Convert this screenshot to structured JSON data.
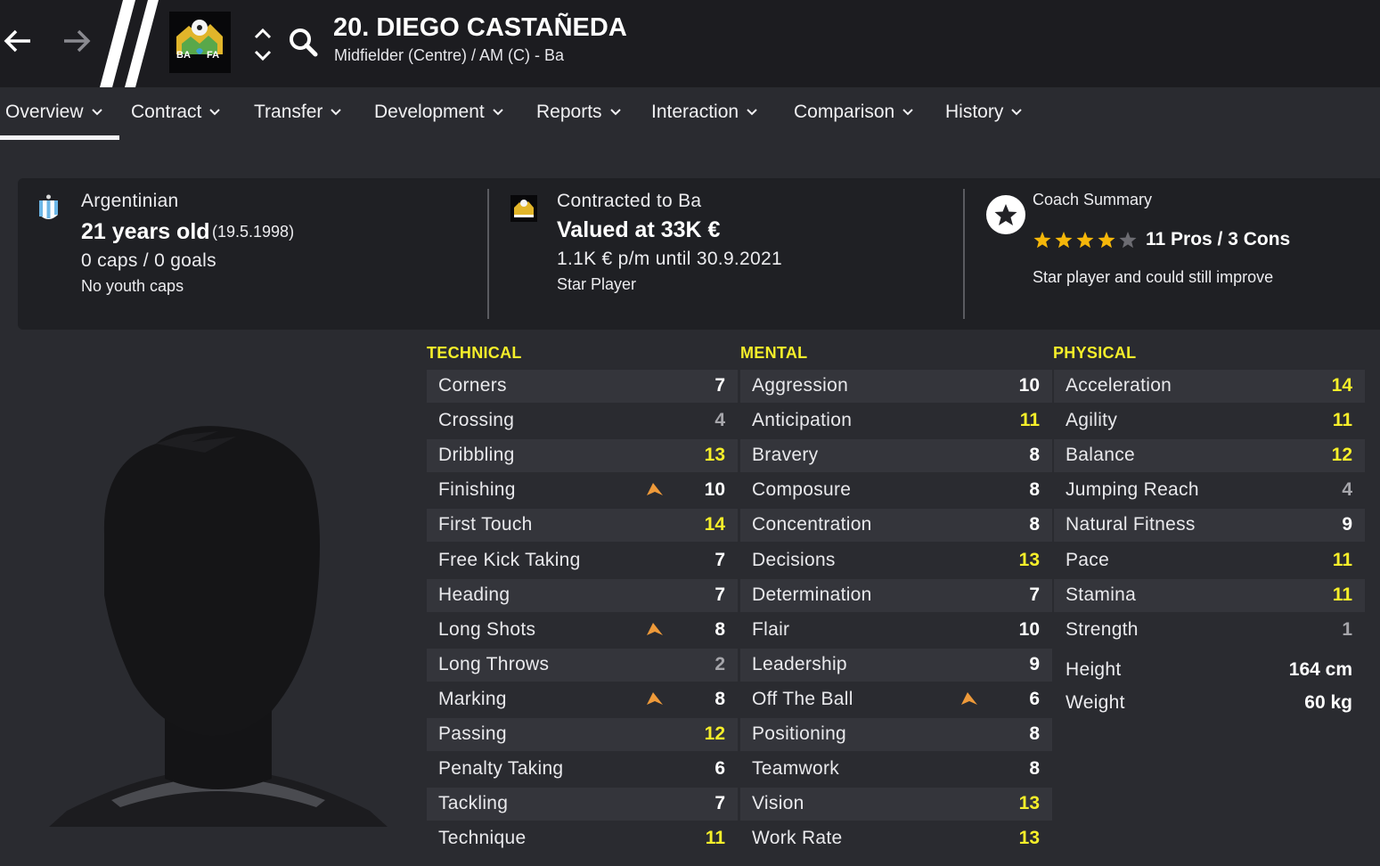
{
  "header": {
    "player_title": "20. DIEGO CASTAÑEDA",
    "player_subtitle": "Midfielder (Centre) / AM (C) - Ba",
    "club_crest_letters_left": "BA",
    "club_crest_letters_right": "FA",
    "icons": [
      "back-arrow-icon",
      "forward-arrow-icon",
      "club-crest",
      "up-down-chevron-icon",
      "search-icon"
    ]
  },
  "tabs": [
    {
      "label": "Overview",
      "active": true
    },
    {
      "label": "Contract"
    },
    {
      "label": "Transfer"
    },
    {
      "label": "Development"
    },
    {
      "label": "Reports"
    },
    {
      "label": "Interaction"
    },
    {
      "label": "Comparison"
    },
    {
      "label": "History"
    }
  ],
  "info": {
    "nationality": "Argentinian",
    "age": "21 years old",
    "dob": "(19.5.1998)",
    "caps": "0 caps / 0 goals",
    "youth_caps": "No youth caps",
    "contracted": "Contracted to Ba",
    "value": "Valued at 33K €",
    "wage": "1.1K € p/m until 30.9.2021",
    "status": "Star Player",
    "coach_title": "Coach Summary",
    "stars": 4,
    "stars_max": 5,
    "pros_cons": "11 Pros / 3 Cons",
    "summary": "Star player and could still improve"
  },
  "colors": {
    "background": "#2a2b30",
    "header": "#1c1c20",
    "card": "#1f2024",
    "accent_yellow": "#f6ef2a",
    "high_value": "#f6ef2a",
    "mid_value": "#ffffff",
    "low_value": "#a6a6ab",
    "star": "#f5b70a",
    "arrow": "#ee9a3a"
  },
  "attributes": {
    "technical": {
      "title": "TECHNICAL",
      "items": [
        {
          "name": "Corners",
          "value": "7"
        },
        {
          "name": "Crossing",
          "value": "4"
        },
        {
          "name": "Dribbling",
          "value": "13"
        },
        {
          "name": "Finishing",
          "value": "10",
          "arrow": true
        },
        {
          "name": "First Touch",
          "value": "14"
        },
        {
          "name": "Free Kick Taking",
          "value": "7"
        },
        {
          "name": "Heading",
          "value": "7"
        },
        {
          "name": "Long Shots",
          "value": "8",
          "arrow": true
        },
        {
          "name": "Long Throws",
          "value": "2"
        },
        {
          "name": "Marking",
          "value": "8",
          "arrow": true
        },
        {
          "name": "Passing",
          "value": "12"
        },
        {
          "name": "Penalty Taking",
          "value": "6"
        },
        {
          "name": "Tackling",
          "value": "7"
        },
        {
          "name": "Technique",
          "value": "11"
        }
      ]
    },
    "mental": {
      "title": "MENTAL",
      "items": [
        {
          "name": "Aggression",
          "value": "10"
        },
        {
          "name": "Anticipation",
          "value": "11"
        },
        {
          "name": "Bravery",
          "value": "8"
        },
        {
          "name": "Composure",
          "value": "8"
        },
        {
          "name": "Concentration",
          "value": "8"
        },
        {
          "name": "Decisions",
          "value": "13"
        },
        {
          "name": "Determination",
          "value": "7"
        },
        {
          "name": "Flair",
          "value": "10"
        },
        {
          "name": "Leadership",
          "value": "9"
        },
        {
          "name": "Off The Ball",
          "value": "6",
          "arrow": true
        },
        {
          "name": "Positioning",
          "value": "8"
        },
        {
          "name": "Teamwork",
          "value": "8"
        },
        {
          "name": "Vision",
          "value": "13"
        },
        {
          "name": "Work Rate",
          "value": "13"
        }
      ]
    },
    "physical": {
      "title": "PHYSICAL",
      "items": [
        {
          "name": "Acceleration",
          "value": "14"
        },
        {
          "name": "Agility",
          "value": "11"
        },
        {
          "name": "Balance",
          "value": "12"
        },
        {
          "name": "Jumping Reach",
          "value": "4"
        },
        {
          "name": "Natural Fitness",
          "value": "9"
        },
        {
          "name": "Pace",
          "value": "11"
        },
        {
          "name": "Stamina",
          "value": "11"
        },
        {
          "name": "Strength",
          "value": "1"
        }
      ],
      "height_label": "Height",
      "height_value": "164 cm",
      "weight_label": "Weight",
      "weight_value": "60 kg"
    }
  }
}
